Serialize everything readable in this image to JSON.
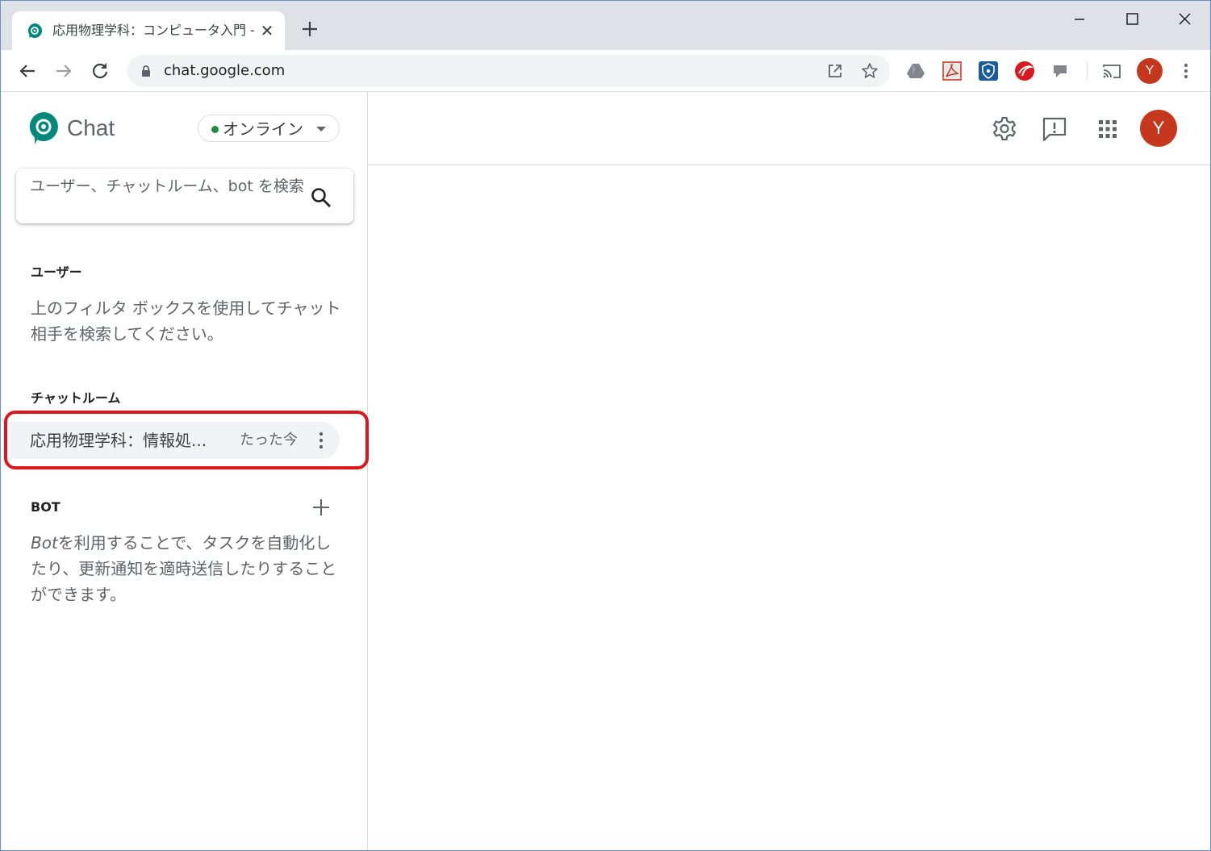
{
  "browser": {
    "tab": {
      "title": "応用物理学科：コンピュータ入門 - C",
      "favicon": "google-chat-icon"
    },
    "address": {
      "url": "chat.google.com"
    },
    "profile_initial": "Y",
    "extensions": [
      "google-drive-icon",
      "acrobat-icon",
      "bitwarden-icon",
      "trend-micro-icon",
      "pushbullet-icon"
    ]
  },
  "app": {
    "name": "Chat",
    "status": "オンライン",
    "status_color": "#1e8e3e",
    "search_placeholder": "ユーザー、チャットルーム、bot を検索"
  },
  "sections": {
    "users": {
      "title": "ユーザー",
      "text": "上のフィルタ ボックスを使用してチャット相手を検索してください。"
    },
    "rooms": {
      "title": "チャットルーム",
      "items": [
        {
          "name": "応用物理学科：情報処...",
          "time": "たった今"
        }
      ]
    },
    "bots": {
      "title": "BOT",
      "text_em": "Bot",
      "text": "を利用することで、タスクを自動化したり、更新通知を適時送信したりすることができます。"
    }
  },
  "header": {
    "avatar_initial": "Y"
  },
  "colors": {
    "avatar": "#c5381e",
    "highlight": "#e0151b",
    "brand": "#00897b"
  }
}
